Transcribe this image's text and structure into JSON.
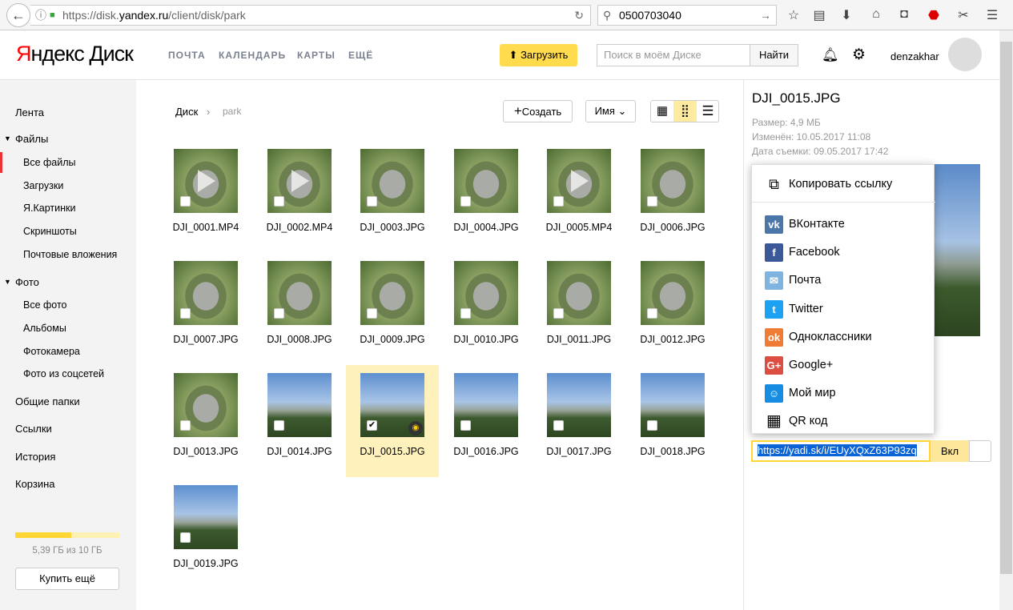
{
  "browser": {
    "url_prefix": "https://disk.",
    "url_domain": "yandex.ru",
    "url_path": "/client/disk/park",
    "search_value": "0500703040"
  },
  "header": {
    "logo_red": "Я",
    "logo_rest": "ндекс",
    "logo_product": "Диск",
    "nav": [
      "ПОЧТА",
      "КАЛЕНДАРЬ",
      "КАРТЫ",
      "ЕЩЁ"
    ],
    "upload": "Загрузить",
    "search_placeholder": "Поиск в моём Диске",
    "find": "Найти",
    "username": "denzakhar"
  },
  "sidebar": {
    "items": [
      "Лента",
      "Файлы",
      "Все файлы",
      "Загрузки",
      "Я.Картинки",
      "Скриншоты",
      "Почтовые вложения",
      "Фото",
      "Все фото",
      "Альбомы",
      "Фотокамера",
      "Фото из соцсетей",
      "Общие папки",
      "Ссылки",
      "История",
      "Корзина"
    ],
    "storage_text": "5,39 ГБ из 10 ГБ",
    "storage_used_fraction": 0.539,
    "buy": "Купить ещё"
  },
  "toolbar": {
    "breadcrumb": [
      "Диск",
      "park"
    ],
    "create": "Создать",
    "sort": "Имя",
    "view_active": "tiles-small"
  },
  "files": [
    {
      "name": "DJI_0001.MP4",
      "type": "video",
      "look": "aerial"
    },
    {
      "name": "DJI_0002.MP4",
      "type": "video",
      "look": "aerial"
    },
    {
      "name": "DJI_0003.JPG",
      "type": "image",
      "look": "aerial"
    },
    {
      "name": "DJI_0004.JPG",
      "type": "image",
      "look": "aerial"
    },
    {
      "name": "DJI_0005.MP4",
      "type": "video",
      "look": "aerial"
    },
    {
      "name": "DJI_0006.JPG",
      "type": "image",
      "look": "aerial"
    },
    {
      "name": "DJI_0007.JPG",
      "type": "image",
      "look": "aerial"
    },
    {
      "name": "DJI_0008.JPG",
      "type": "image",
      "look": "aerial"
    },
    {
      "name": "DJI_0009.JPG",
      "type": "image",
      "look": "aerial"
    },
    {
      "name": "DJI_0010.JPG",
      "type": "image",
      "look": "aerial"
    },
    {
      "name": "DJI_0011.JPG",
      "type": "image",
      "look": "aerial"
    },
    {
      "name": "DJI_0012.JPG",
      "type": "image",
      "look": "aerial"
    },
    {
      "name": "DJI_0013.JPG",
      "type": "image",
      "look": "aerial"
    },
    {
      "name": "DJI_0014.JPG",
      "type": "image",
      "look": "sky"
    },
    {
      "name": "DJI_0015.JPG",
      "type": "image",
      "look": "sky",
      "selected": true
    },
    {
      "name": "DJI_0016.JPG",
      "type": "image",
      "look": "sky"
    },
    {
      "name": "DJI_0017.JPG",
      "type": "image",
      "look": "sky"
    },
    {
      "name": "DJI_0018.JPG",
      "type": "image",
      "look": "sky"
    },
    {
      "name": "DJI_0019.JPG",
      "type": "image",
      "look": "sky"
    }
  ],
  "panel": {
    "title": "DJI_0015.JPG",
    "size": "Размер: 4,9 МБ",
    "modified": "Изменён: 10.05.2017 11:08",
    "shot": "Дата съемки: 09.05.2017 17:42",
    "link": "https://yadi.sk/i/EUyXQxZ63P93zq",
    "toggle": "Вкл"
  },
  "share_menu": {
    "copy": "Копировать ссылку",
    "items": [
      {
        "label": "ВКонтакте",
        "icon": "vk-icon",
        "color": "#4a76a8",
        "glyph": "vk"
      },
      {
        "label": "Facebook",
        "icon": "facebook-icon",
        "color": "#3b5998",
        "glyph": "f"
      },
      {
        "label": "Почта",
        "icon": "mail-icon",
        "color": "#7fb3e0",
        "glyph": "✉"
      },
      {
        "label": "Twitter",
        "icon": "twitter-icon",
        "color": "#1da1f2",
        "glyph": "t"
      },
      {
        "label": "Одноклассники",
        "icon": "odnoklassniki-icon",
        "color": "#f07b34",
        "glyph": "ok"
      },
      {
        "label": "Google+",
        "icon": "google-plus-icon",
        "color": "#dc4e41",
        "glyph": "G+"
      },
      {
        "label": "Мой мир",
        "icon": "moi-mir-icon",
        "color": "#168de2",
        "glyph": "☺"
      },
      {
        "label": "QR код",
        "icon": "qr-code-icon",
        "color": "#ffffff",
        "glyph": "▦"
      }
    ]
  }
}
